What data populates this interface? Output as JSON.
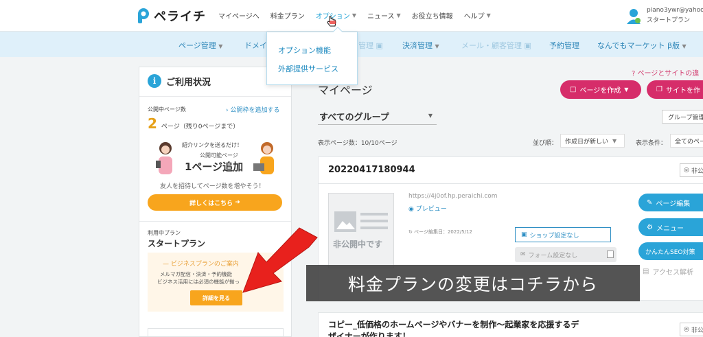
{
  "header": {
    "logo_text": "ペライチ",
    "nav": [
      {
        "label": "マイページへ",
        "has_chevron": false
      },
      {
        "label": "料金プラン",
        "has_chevron": false
      },
      {
        "label": "オプション",
        "has_chevron": true,
        "active": true
      },
      {
        "label": "ニュース",
        "has_chevron": true
      },
      {
        "label": "お役立ち情報",
        "has_chevron": false
      },
      {
        "label": "ヘルプ",
        "has_chevron": true
      }
    ],
    "user": {
      "email": "piano3ywr@yahoo.c",
      "plan": "スタートプラン"
    }
  },
  "subnav": {
    "items": [
      {
        "label": "ページ管理",
        "chevron": true
      },
      {
        "label": "ドメイ",
        "chevron": false
      },
      {
        "label": "管理",
        "dim": true,
        "lock": true
      },
      {
        "label": "決済管理",
        "chevron": true
      },
      {
        "label": "メール・顧客管理",
        "dim": true,
        "lock": true
      },
      {
        "label": "予約管理",
        "chevron": false
      },
      {
        "label": "なんでもマーケット β版",
        "chevron": true
      }
    ]
  },
  "dropdown": {
    "items": [
      "オプション機能",
      "外部提供サービス"
    ]
  },
  "left_panel": {
    "title": "ご利用状況",
    "published_label": "公開中ページ数",
    "add_link": "公開枠を追加する",
    "page_count": "2",
    "page_unit": "ページ（残り0ページまで）",
    "banner": {
      "line1": "紹介リンクを送るだけ！",
      "line2": "公開可能ページ",
      "line3": "1ページ追加"
    },
    "invite_text": "友人を招待してページ数を増やそう！",
    "details_button": "詳しくはこちら",
    "plan_label": "利用中プラン",
    "plan_name": "スタートプラン",
    "biz": {
      "title": "— ビジネスプランのご案内",
      "desc1": "メルマガ配信・決済・予約機能",
      "desc2": "ビジネス活用には必須の機能が揃っ",
      "button": "詳細を見る"
    }
  },
  "main": {
    "help_link": "ページとサイトの違",
    "title": "マイページ",
    "create_page": "ページを作成",
    "create_site": "サイトを作",
    "group_select": "すべてのグループ",
    "group_manage": "グループ管理",
    "count_text": "表示ページ数：10/10ページ",
    "sort_label": "並び順：",
    "sort_value": "作成日が新しい",
    "filter_label": "表示条件：",
    "filter_value": "全てのペー",
    "card": {
      "title": "20220417180944",
      "private_label": "非公",
      "thumb_stamp": "非公開中です",
      "url": "https://4j0of.hp.peraichi.com",
      "preview": "プレビュー",
      "edited": "ページ編集日：2022/5/12",
      "shop": "ショップ設定なし",
      "form": "フォーム設定なし",
      "side_buttons": [
        "ページ編集",
        "メニュー",
        "かんたんSEO対策"
      ],
      "access": "アクセス解析"
    },
    "card2": {
      "line1": "コピー_低価格のホームページやバナーを制作～起業家を応援するデ",
      "line2": "ザイナーが作ります！",
      "private_label": "非公"
    }
  },
  "caption": "料金プランの変更はコチラから",
  "colors": {
    "accent": "#2aa4d8",
    "orange": "#f8a51d",
    "pink": "#d62d6a",
    "arrow_red": "#e8211d"
  }
}
